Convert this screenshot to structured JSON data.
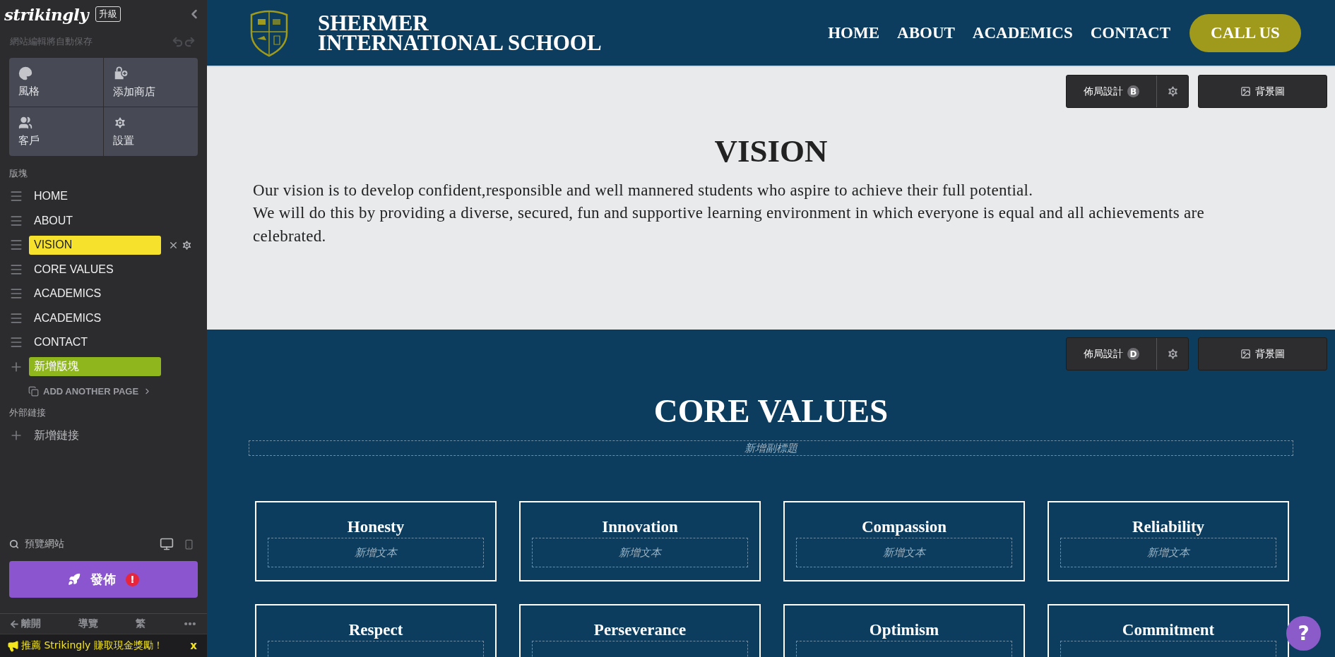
{
  "sidebar": {
    "logo": "strikingly",
    "upgrade": "升級",
    "autosave": "網站編輯將自動保存",
    "tools": [
      {
        "label": "風格"
      },
      {
        "label": "添加商店"
      },
      {
        "label": "客戶"
      },
      {
        "label": "設置"
      }
    ],
    "sections_label": "版塊",
    "sections": [
      {
        "label": "HOME",
        "selected": false
      },
      {
        "label": "ABOUT",
        "selected": false
      },
      {
        "label": "VISION",
        "selected": true
      },
      {
        "label": "CORE VALUES",
        "selected": false
      },
      {
        "label": "ACADEMICS",
        "selected": false
      },
      {
        "label": "ACADEMICS",
        "selected": false
      },
      {
        "label": "CONTACT",
        "selected": false
      }
    ],
    "add_section": "新增版塊",
    "add_page": "ADD ANOTHER PAGE",
    "external_label": "外部鏈接",
    "add_link": "新增鏈接",
    "preview": "預覽網站",
    "publish": "發佈",
    "publish_alert": "!",
    "footer": [
      {
        "label": "離開"
      },
      {
        "label": "導覽"
      },
      {
        "label": "繁"
      }
    ],
    "promo": "推薦 Strikingly 賺取現金獎勵！",
    "promo_close": "x"
  },
  "site": {
    "brand": [
      "SHERMER",
      "INTERNATIONAL SCHOOL"
    ],
    "nav": [
      {
        "label": "HOME"
      },
      {
        "label": "ABOUT"
      },
      {
        "label": "ACADEMICS"
      },
      {
        "label": "CONTACT"
      }
    ],
    "cta": "CALL US"
  },
  "sections": [
    {
      "kind": "text",
      "layout": "佈局設計",
      "badge": "B",
      "background": "背景圖",
      "title": "VISION",
      "paragraphs": [
        "Our vision is to develop confident,responsible and well mannered students who aspire to achieve their full potential.",
        "We will do this by providing a diverse, secured, fun and supportive learning environment in which everyone is equal and all achievements are celebrated."
      ]
    },
    {
      "kind": "cards",
      "layout": "佈局設計",
      "badge": "D",
      "background": "背景圖",
      "title": "CORE VALUES",
      "subtitle_placeholder": "新增副標題",
      "cards": [
        {
          "title": "Honesty",
          "placeholder": "新增文本"
        },
        {
          "title": "Innovation",
          "placeholder": "新增文本"
        },
        {
          "title": "Compassion",
          "placeholder": "新增文本"
        },
        {
          "title": "Reliability",
          "placeholder": "新增文本"
        },
        {
          "title": "Respect"
        },
        {
          "title": "Perseverance"
        },
        {
          "title": "Optimism"
        },
        {
          "title": "Commitment"
        }
      ]
    }
  ],
  "help": "?"
}
